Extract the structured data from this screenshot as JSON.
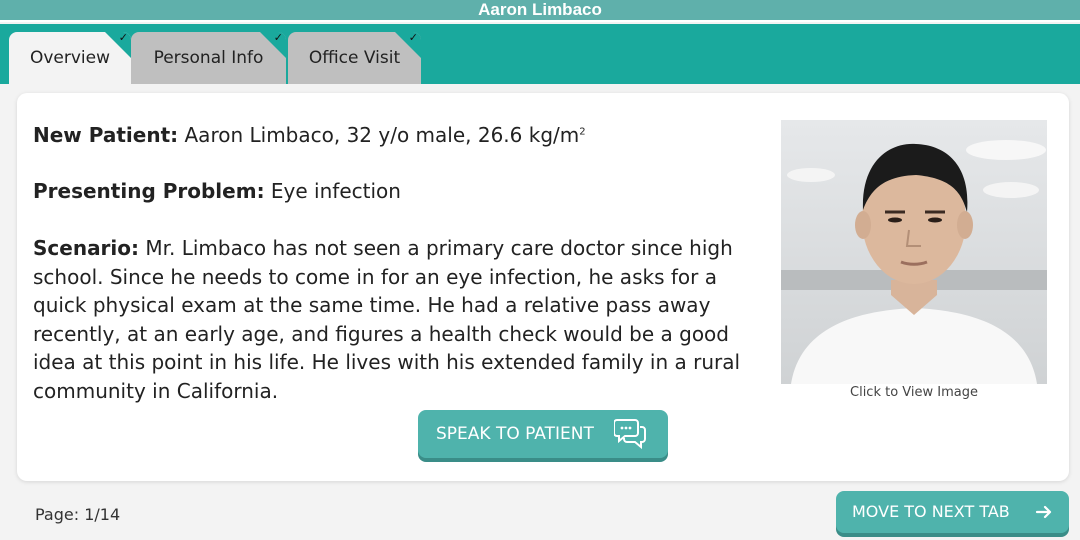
{
  "window": {
    "title": "Aaron Limbaco"
  },
  "tabs": [
    {
      "label": "Overview",
      "active": true,
      "completed": true
    },
    {
      "label": "Personal Info",
      "active": false,
      "completed": true
    },
    {
      "label": "Office Visit",
      "active": false,
      "completed": true
    }
  ],
  "overview": {
    "new_patient_label": "New Patient:",
    "new_patient_value": "Aaron Limbaco, 32 y/o male, 26.6 kg/m",
    "new_patient_sup": "2",
    "problem_label": "Presenting Problem:",
    "problem_value": "Eye infection",
    "scenario_label": "Scenario:",
    "scenario_text": "Mr. Limbaco has not seen a primary care doctor since high school. Since he needs to come in for an eye infection, he asks for a quick physical exam at the same time. He had a relative pass away recently, at an early age, and figures a health check would be a good idea at this point in his life. He lives with his extended family in a rural community in California."
  },
  "photo": {
    "caption": "Click to View Image"
  },
  "actions": {
    "speak_label": "SPEAK TO PATIENT",
    "next_label": "MOVE TO NEXT TAB"
  },
  "footer": {
    "page_label": "Page: 1/14"
  },
  "colors": {
    "teal": "#1aa99d",
    "button": "#4fb3ac",
    "title_bar": "#5fb0ab"
  }
}
